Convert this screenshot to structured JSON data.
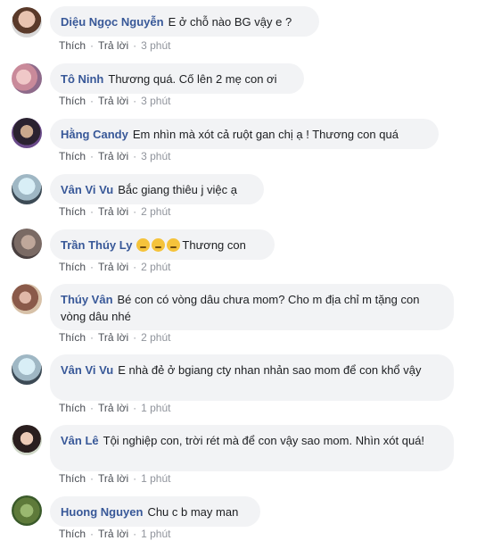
{
  "labels": {
    "like": "Thích",
    "reply": "Trả lời"
  },
  "emoji_name": "sad-face",
  "colors": {
    "author": "#385898",
    "bubble": "#f2f3f5",
    "meta": "#90949c"
  },
  "comments": [
    {
      "author": "Diệu Ngọc Nguyễn",
      "text": "E ở chỗ nào BG vậy e ?",
      "time": "3 phút"
    },
    {
      "author": "Tô Ninh",
      "text": "Thương quá. Cố lên 2 mẹ con ơi",
      "time": "3 phút"
    },
    {
      "author": "Hằng Candy",
      "text": "Em nhìn mà xót cả ruột gan chị ạ ! Thương con quá",
      "time": "3 phút"
    },
    {
      "author": "Vân Vi Vu",
      "text": "Bắc giang thiêu j việc ạ",
      "time": "2 phút"
    },
    {
      "author": "Trần Thúy Ly",
      "text": "Thương con",
      "time": "2 phút"
    },
    {
      "author": "Thúy Vân",
      "text": "Bé con có vòng dâu chưa mom? Cho m địa chỉ m tặng con vòng dâu nhé",
      "time": "2 phút"
    },
    {
      "author": "Vân Vi Vu",
      "text": "E nhà đẻ ở bgiang cty nhan nhản sao mom để con khổ vậy",
      "time": "1 phút"
    },
    {
      "author": "Vân Lê",
      "text": "Tội nghiệp con, trời rét mà để con vậy sao mom. Nhìn xót quá!",
      "time": "1 phút"
    },
    {
      "author": "Huong Nguyen",
      "text": "Chu c b may man",
      "time": "1 phút"
    }
  ]
}
